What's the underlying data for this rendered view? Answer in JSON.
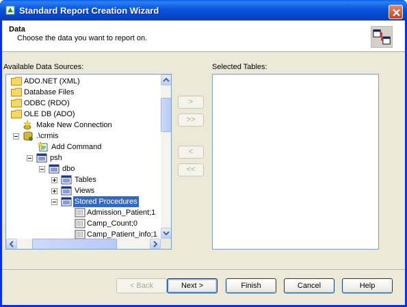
{
  "window": {
    "title": "Standard Report Creation Wizard"
  },
  "header": {
    "title": "Data",
    "subtitle": "Choose the data you want to report on."
  },
  "available_label": "Available Data Sources:",
  "selected_label": "Selected Tables:",
  "tree": {
    "items": [
      {
        "label": "ADO.NET (XML)",
        "icon": "folder-icon"
      },
      {
        "label": "Database Files",
        "icon": "folder-icon"
      },
      {
        "label": "ODBC (RDO)",
        "icon": "folder-icon"
      },
      {
        "label": "OLE DB (ADO)",
        "icon": "folder-icon"
      },
      {
        "label": "Make New Connection",
        "icon": "new-connection-icon"
      },
      {
        "label": ".\\crmis",
        "icon": "database-server-icon"
      },
      {
        "label": "Add Command",
        "icon": "add-command-icon"
      },
      {
        "label": "psh",
        "icon": "database-icon"
      },
      {
        "label": "dbo",
        "icon": "database-icon"
      },
      {
        "label": "Tables",
        "icon": "table-group-icon"
      },
      {
        "label": "Views",
        "icon": "table-group-icon"
      },
      {
        "label": "Stored Procedures",
        "icon": "table-group-icon",
        "selected": true
      },
      {
        "label": "Admission_Patient;1",
        "icon": "stored-procedure-icon"
      },
      {
        "label": "Camp_Count;0",
        "icon": "stored-procedure-icon"
      },
      {
        "label": "Camp_Patient_info;1",
        "icon": "stored-procedure-icon"
      }
    ]
  },
  "transfer": {
    "add": ">",
    "add_all": ">>",
    "remove": "<",
    "remove_all": "<<"
  },
  "footer": {
    "back": "< Back",
    "next": "Next >",
    "finish": "Finish",
    "cancel": "Cancel",
    "help": "Help"
  },
  "colors": {
    "titlebar": "#0855dd",
    "selection": "#316ac5",
    "dialog_bg": "#ece9d8"
  }
}
